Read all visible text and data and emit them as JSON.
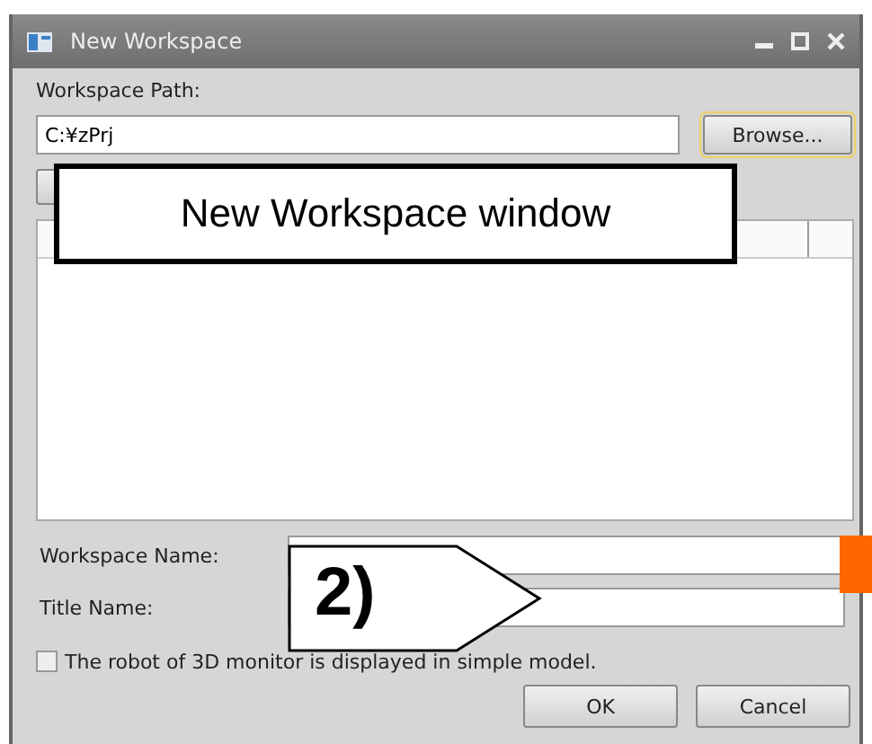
{
  "window": {
    "title": "New Workspace"
  },
  "workspace_path": {
    "label": "Workspace Path:",
    "value": "C:¥zPrj"
  },
  "browse_button": {
    "label": "Browse...",
    "focused": true
  },
  "workspace_name": {
    "label": "Workspace Name:"
  },
  "title_name": {
    "label": "Title Name:"
  },
  "simple_model_checkbox": {
    "label": "The robot of 3D monitor is displayed in simple model.",
    "checked": false
  },
  "buttons": [
    "OK",
    "Cancel"
  ],
  "callouts": [
    {
      "kind": "box",
      "text": "New Workspace window"
    },
    {
      "kind": "arrow",
      "text": "2)"
    }
  ]
}
